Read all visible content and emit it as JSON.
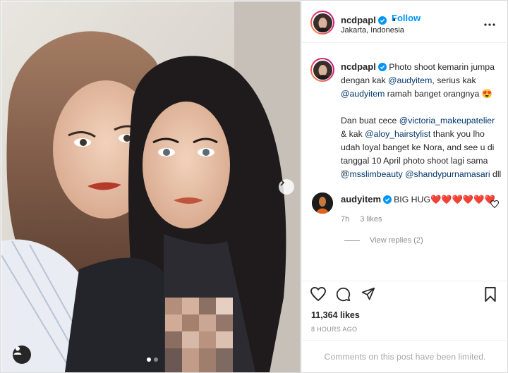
{
  "post": {
    "author": "ncdpapl",
    "follow_label": "Follow",
    "separator": "•",
    "location": "Jakarta, Indonesia",
    "more_icon": "more-horizontal-icon",
    "carousel": {
      "total": 2,
      "current": 1
    }
  },
  "caption": {
    "username": "ncdpapl",
    "seg": [
      "Photo shoot kemarin jumpa dengan kak ",
      "@audyitem",
      ", serius kak ",
      "@audyitem",
      " ramah banget orangnya ",
      "😍",
      "Dan buat cece ",
      "@victoria_makeupatelier",
      " & kak ",
      "@aloy_hairstylist",
      " thank you lho udah loyal banget ke Nora, and see u di tanggal 10 April photo shoot lagi sama ",
      "@msslimbeauty",
      " ",
      "@shandypurnamasari",
      " dll"
    ],
    "time": "8h"
  },
  "comment": {
    "username": "audyitem",
    "text": "BIG HUG❤️❤️❤️❤️❤️❤️",
    "time": "7h",
    "likes": "3 likes",
    "view_replies": "View replies (2)"
  },
  "stats": {
    "likes": "11,364 likes",
    "posted": "8 HOURS AGO"
  },
  "footer": {
    "limited": "Comments on this post have been limited."
  },
  "colors": {
    "link": "#0095f6",
    "mention": "#00376b",
    "verified": "#0095f6",
    "muted": "#8e8e8e"
  }
}
